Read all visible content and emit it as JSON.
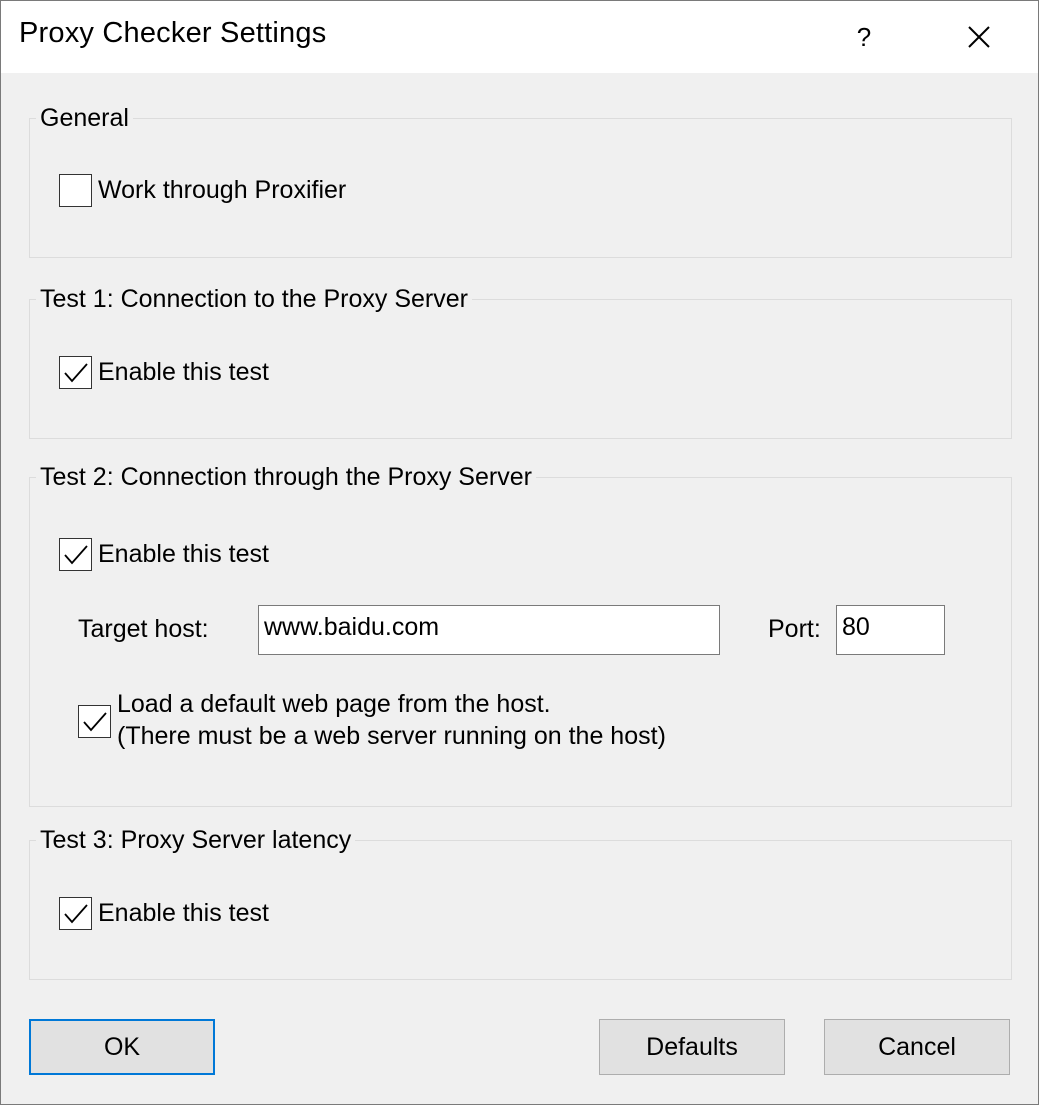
{
  "window": {
    "title": "Proxy Checker Settings",
    "help_label": "?"
  },
  "general": {
    "title": "General",
    "proxifier": {
      "label": "Work through Proxifier",
      "checked": false
    }
  },
  "test1": {
    "title": "Test 1: Connection to the Proxy Server",
    "enable": {
      "label": "Enable this test",
      "checked": true
    }
  },
  "test2": {
    "title": "Test 2: Connection through the Proxy Server",
    "enable": {
      "label": "Enable this test",
      "checked": true
    },
    "target_host_label": "Target host:",
    "target_host_value": "www.baidu.com",
    "port_label": "Port:",
    "port_value": "80",
    "load_page": {
      "line1": "Load a default web page from the host.",
      "line2": "(There must be a web server running on the host)",
      "checked": true
    }
  },
  "test3": {
    "title": "Test 3: Proxy Server latency",
    "enable": {
      "label": "Enable this test",
      "checked": true
    }
  },
  "buttons": {
    "ok": "OK",
    "defaults": "Defaults",
    "cancel": "Cancel"
  }
}
